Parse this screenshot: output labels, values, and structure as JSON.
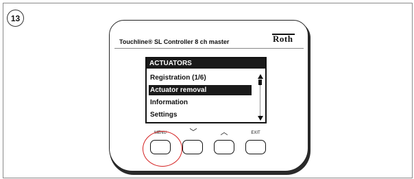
{
  "step_number": "13",
  "device": {
    "title": "Touchline® SL Controller 8 ch master",
    "brand": "Roth"
  },
  "screen": {
    "header": "ACTUATORS",
    "items": [
      {
        "label": "Registration (1/6)",
        "selected": false
      },
      {
        "label": "Actuator removal",
        "selected": true
      },
      {
        "label": "Information",
        "selected": false
      },
      {
        "label": "Settings",
        "selected": false
      }
    ]
  },
  "buttons": [
    {
      "label": "MENU",
      "icon": "menu-label"
    },
    {
      "label": "",
      "icon": "chevron-down-icon",
      "glyph": "﹀"
    },
    {
      "label": "",
      "icon": "chevron-up-icon",
      "glyph": "︿"
    },
    {
      "label": "EXIT",
      "icon": "exit-label"
    }
  ],
  "highlight": {
    "target": "MENU",
    "color": "#d42020"
  }
}
